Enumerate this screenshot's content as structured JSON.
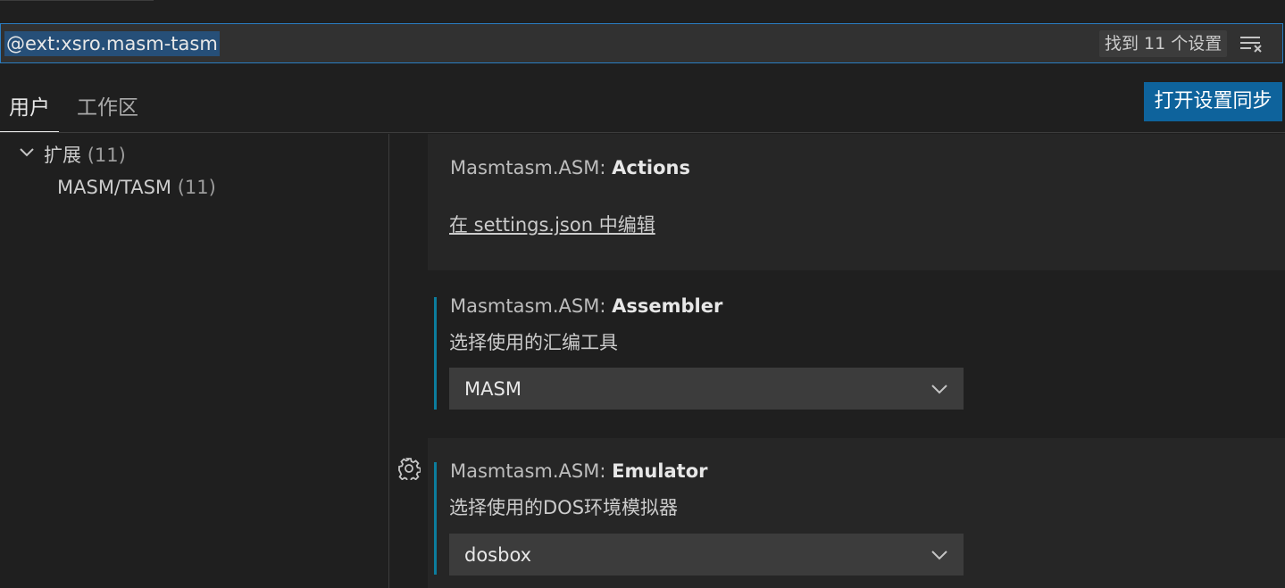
{
  "search": {
    "value": "@ext:xsro.masm-tasm",
    "result_count": "找到 11 个设置"
  },
  "tabs": [
    {
      "label": "用户"
    },
    {
      "label": "工作区"
    }
  ],
  "sync_button_label": "打开设置同步",
  "tree": {
    "group": {
      "label": "扩展",
      "count": "(11)"
    },
    "child": {
      "label": "MASM/TASM",
      "count": "(11)"
    }
  },
  "settings": [
    {
      "prefix": "Masmtasm.ASM: ",
      "name": "Actions",
      "link": "在 settings.json 中编辑"
    },
    {
      "prefix": "Masmtasm.ASM: ",
      "name": "Assembler",
      "description": "选择使用的汇编工具",
      "value": "MASM"
    },
    {
      "prefix": "Masmtasm.ASM: ",
      "name": "Emulator",
      "description": "选择使用的DOS环境模拟器",
      "value": "dosbox"
    }
  ],
  "colors": {
    "accent": "#0e639c",
    "modified_indicator": "#0c7d9d",
    "focus_border": "#2a7dc2",
    "selection": "#264f78"
  },
  "icons": [
    "clear-filter-icon",
    "chevron-down-icon",
    "gear-icon",
    "dropdown-chevron-icon"
  ]
}
